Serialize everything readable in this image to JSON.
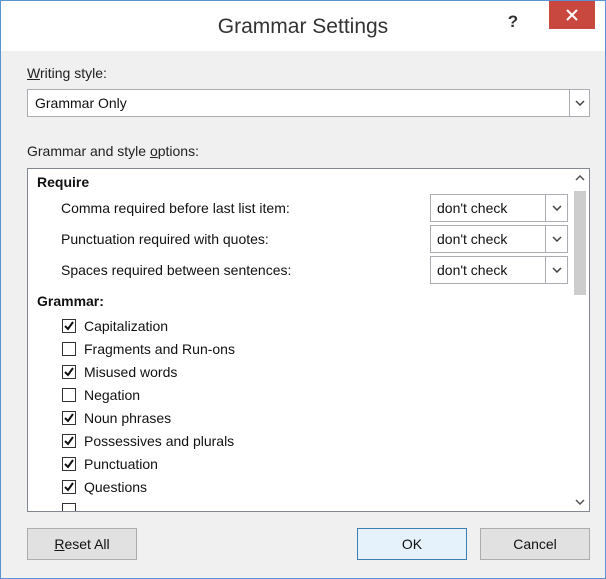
{
  "window": {
    "title": "Grammar Settings",
    "help_label": "?",
    "close_icon": "close-icon",
    "close_color": "#c8473e",
    "accent_border": "#5a93d3"
  },
  "writing_style": {
    "label_prefix_u": "W",
    "label_rest": "riting style:",
    "value": "Grammar Only"
  },
  "options_section": {
    "label_pre": "Grammar and style ",
    "label_u": "o",
    "label_post": "ptions:"
  },
  "require": {
    "heading": "Require",
    "rows": [
      {
        "label": "Comma required before last list item:",
        "value": "don't check"
      },
      {
        "label": "Punctuation required with quotes:",
        "value": "don't check"
      },
      {
        "label": "Spaces required between sentences:",
        "value": "don't check"
      }
    ]
  },
  "grammar": {
    "heading": "Grammar:",
    "items": [
      {
        "label": "Capitalization",
        "checked": true
      },
      {
        "label": "Fragments and Run-ons",
        "checked": false
      },
      {
        "label": "Misused words",
        "checked": true
      },
      {
        "label": "Negation",
        "checked": false
      },
      {
        "label": "Noun phrases",
        "checked": true
      },
      {
        "label": "Possessives and plurals",
        "checked": true
      },
      {
        "label": "Punctuation",
        "checked": true
      },
      {
        "label": "Questions",
        "checked": true
      }
    ]
  },
  "buttons": {
    "reset_u": "R",
    "reset_rest": "eset All",
    "ok": "OK",
    "cancel": "Cancel"
  }
}
